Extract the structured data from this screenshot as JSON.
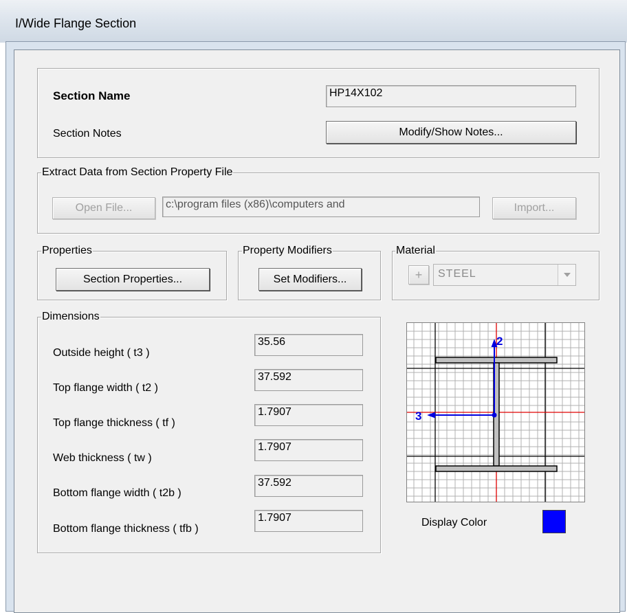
{
  "window": {
    "title": "I/Wide Flange Section"
  },
  "section": {
    "name_label": "Section Name",
    "name_value": "HP14X102",
    "notes_label": "Section Notes",
    "notes_button": "Modify/Show Notes..."
  },
  "extract": {
    "legend": "Extract Data from Section Property File",
    "open_button": "Open File...",
    "path_value": "c:\\program files (x86)\\computers and",
    "import_button": "Import..."
  },
  "properties": {
    "legend": "Properties",
    "button": "Section Properties..."
  },
  "modifiers": {
    "legend": "Property Modifiers",
    "button": "Set Modifiers..."
  },
  "material": {
    "legend": "Material",
    "plus": "+",
    "value": "STEEL"
  },
  "dimensions": {
    "legend": "Dimensions",
    "rows": [
      {
        "label": "Outside height  ( t3 )",
        "value": "35.56"
      },
      {
        "label": "Top flange width  ( t2 )",
        "value": "37.592"
      },
      {
        "label": "Top flange thickness  ( tf )",
        "value": "1.7907"
      },
      {
        "label": "Web thickness  ( tw )",
        "value": "1.7907"
      },
      {
        "label": "Bottom flange width  ( t2b )",
        "value": "37.592"
      },
      {
        "label": "Bottom flange thickness  ( tfb )",
        "value": "1.7907"
      }
    ]
  },
  "preview": {
    "axis2": "2",
    "axis3": "3"
  },
  "display_color": {
    "label": "Display Color",
    "color": "#0000ff"
  }
}
